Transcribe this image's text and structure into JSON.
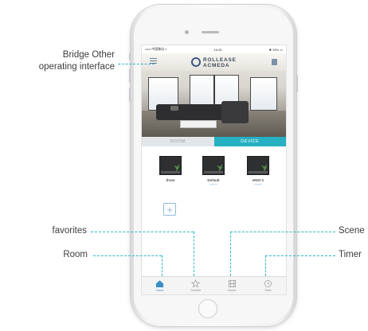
{
  "annotations": {
    "bridge_line1": "Bridge Other",
    "bridge_line2": "operating interface",
    "favorites": "favorites",
    "room": "Room",
    "scene": "Scene",
    "timer": "Timer"
  },
  "app": {
    "statusbar": {
      "carrier": "••••• 中国移动 ▿",
      "time": "16:26",
      "battery": "✸ 33% ▭"
    },
    "logo_line1": "ROLLEASE",
    "logo_line2": "ACMEDA",
    "tabs": {
      "room": "ROOM",
      "device": "DEVICE"
    },
    "devices": [
      {
        "name": "three"
      },
      {
        "name": "Default"
      },
      {
        "name": "eNIO-1"
      }
    ],
    "add_symbol": "+",
    "nav": {
      "home": "Home",
      "favorite": "Favorite",
      "scene": "Scene",
      "timer": "Timer"
    }
  },
  "colors": {
    "accent": "#26b0c2",
    "dashed_line": "#2fb7cc",
    "nav_active": "#3a8fc7"
  }
}
